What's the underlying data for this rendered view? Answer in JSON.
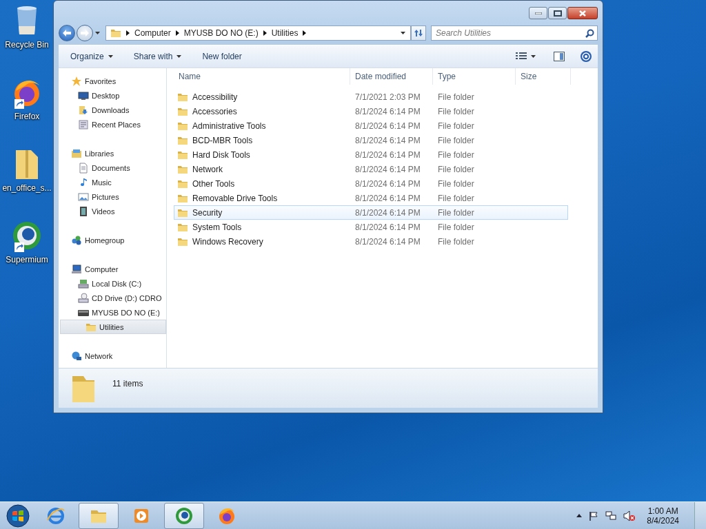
{
  "desktop_icons": [
    {
      "label": "Recycle Bin",
      "kind": "recycle",
      "shortcut": false
    },
    {
      "label": "Firefox",
      "kind": "firefox",
      "shortcut": true
    },
    {
      "label": "en_office_s...",
      "kind": "zip",
      "shortcut": false
    },
    {
      "label": "Supermium",
      "kind": "supermium",
      "shortcut": true
    }
  ],
  "window": {
    "address": {
      "path": [
        "Computer",
        "MYUSB DO NO (E:)",
        "Utilities"
      ]
    },
    "search": {
      "placeholder": "Search Utilities"
    },
    "toolbar": [
      {
        "label": "Organize",
        "dropdown": true
      },
      {
        "label": "Share with",
        "dropdown": true
      },
      {
        "label": "New folder",
        "dropdown": false
      }
    ],
    "sidebar": {
      "items": [
        {
          "label": "Favorites",
          "kind": "star",
          "selected": false,
          "children": [
            {
              "label": "Desktop",
              "kind": "desktop",
              "selected": false
            },
            {
              "label": "Downloads",
              "kind": "downloads",
              "selected": false
            },
            {
              "label": "Recent Places",
              "kind": "recent",
              "selected": false
            }
          ]
        },
        {
          "label": "Libraries",
          "kind": "libraries",
          "selected": false,
          "children": [
            {
              "label": "Documents",
              "kind": "documents",
              "selected": false
            },
            {
              "label": "Music",
              "kind": "music",
              "selected": false
            },
            {
              "label": "Pictures",
              "kind": "pictures",
              "selected": false
            },
            {
              "label": "Videos",
              "kind": "videos",
              "selected": false
            }
          ]
        },
        {
          "label": "Homegroup",
          "kind": "homegroup",
          "selected": false
        },
        {
          "label": "Computer",
          "kind": "computer",
          "selected": false,
          "children": [
            {
              "label": "Local Disk (C:)",
              "kind": "disk",
              "selected": false
            },
            {
              "label": "CD Drive (D:) CDRO",
              "kind": "cd",
              "selected": false
            },
            {
              "label": "MYUSB DO NO (E:)",
              "kind": "usb",
              "selected": false,
              "children": [
                {
                  "label": "Utilities",
                  "kind": "folder",
                  "selected": true
                }
              ]
            }
          ]
        },
        {
          "label": "Network",
          "kind": "network",
          "selected": false
        }
      ]
    },
    "table": {
      "columns": [
        "Name",
        "Date modified",
        "Type",
        "Size"
      ],
      "rows": [
        {
          "name": "Accessibility",
          "date": "7/1/2021 2:03 PM",
          "type": "File folder",
          "selected": false
        },
        {
          "name": "Accessories",
          "date": "8/1/2024 6:14 PM",
          "type": "File folder",
          "selected": false
        },
        {
          "name": "Administrative Tools",
          "date": "8/1/2024 6:14 PM",
          "type": "File folder",
          "selected": false
        },
        {
          "name": "BCD-MBR Tools",
          "date": "8/1/2024 6:14 PM",
          "type": "File folder",
          "selected": false
        },
        {
          "name": "Hard Disk Tools",
          "date": "8/1/2024 6:14 PM",
          "type": "File folder",
          "selected": false
        },
        {
          "name": "Network",
          "date": "8/1/2024 6:14 PM",
          "type": "File folder",
          "selected": false
        },
        {
          "name": "Other Tools",
          "date": "8/1/2024 6:14 PM",
          "type": "File folder",
          "selected": false
        },
        {
          "name": "Removable Drive Tools",
          "date": "8/1/2024 6:14 PM",
          "type": "File folder",
          "selected": false
        },
        {
          "name": "Security",
          "date": "8/1/2024 6:14 PM",
          "type": "File folder",
          "selected": true
        },
        {
          "name": "System Tools",
          "date": "8/1/2024 6:14 PM",
          "type": "File folder",
          "selected": false
        },
        {
          "name": "Windows Recovery",
          "date": "8/1/2024 6:14 PM",
          "type": "File folder",
          "selected": false
        }
      ]
    },
    "status_bar": {
      "count": "11 items"
    }
  },
  "taskbar": {
    "items": [
      {
        "kind": "ie",
        "active": false
      },
      {
        "kind": "explorer",
        "active": true
      },
      {
        "kind": "media",
        "active": false
      },
      {
        "kind": "supermium",
        "active": true
      },
      {
        "kind": "firefox",
        "active": false
      }
    ],
    "clock": {
      "time": "1:00 AM",
      "date": "8/4/2024"
    }
  }
}
